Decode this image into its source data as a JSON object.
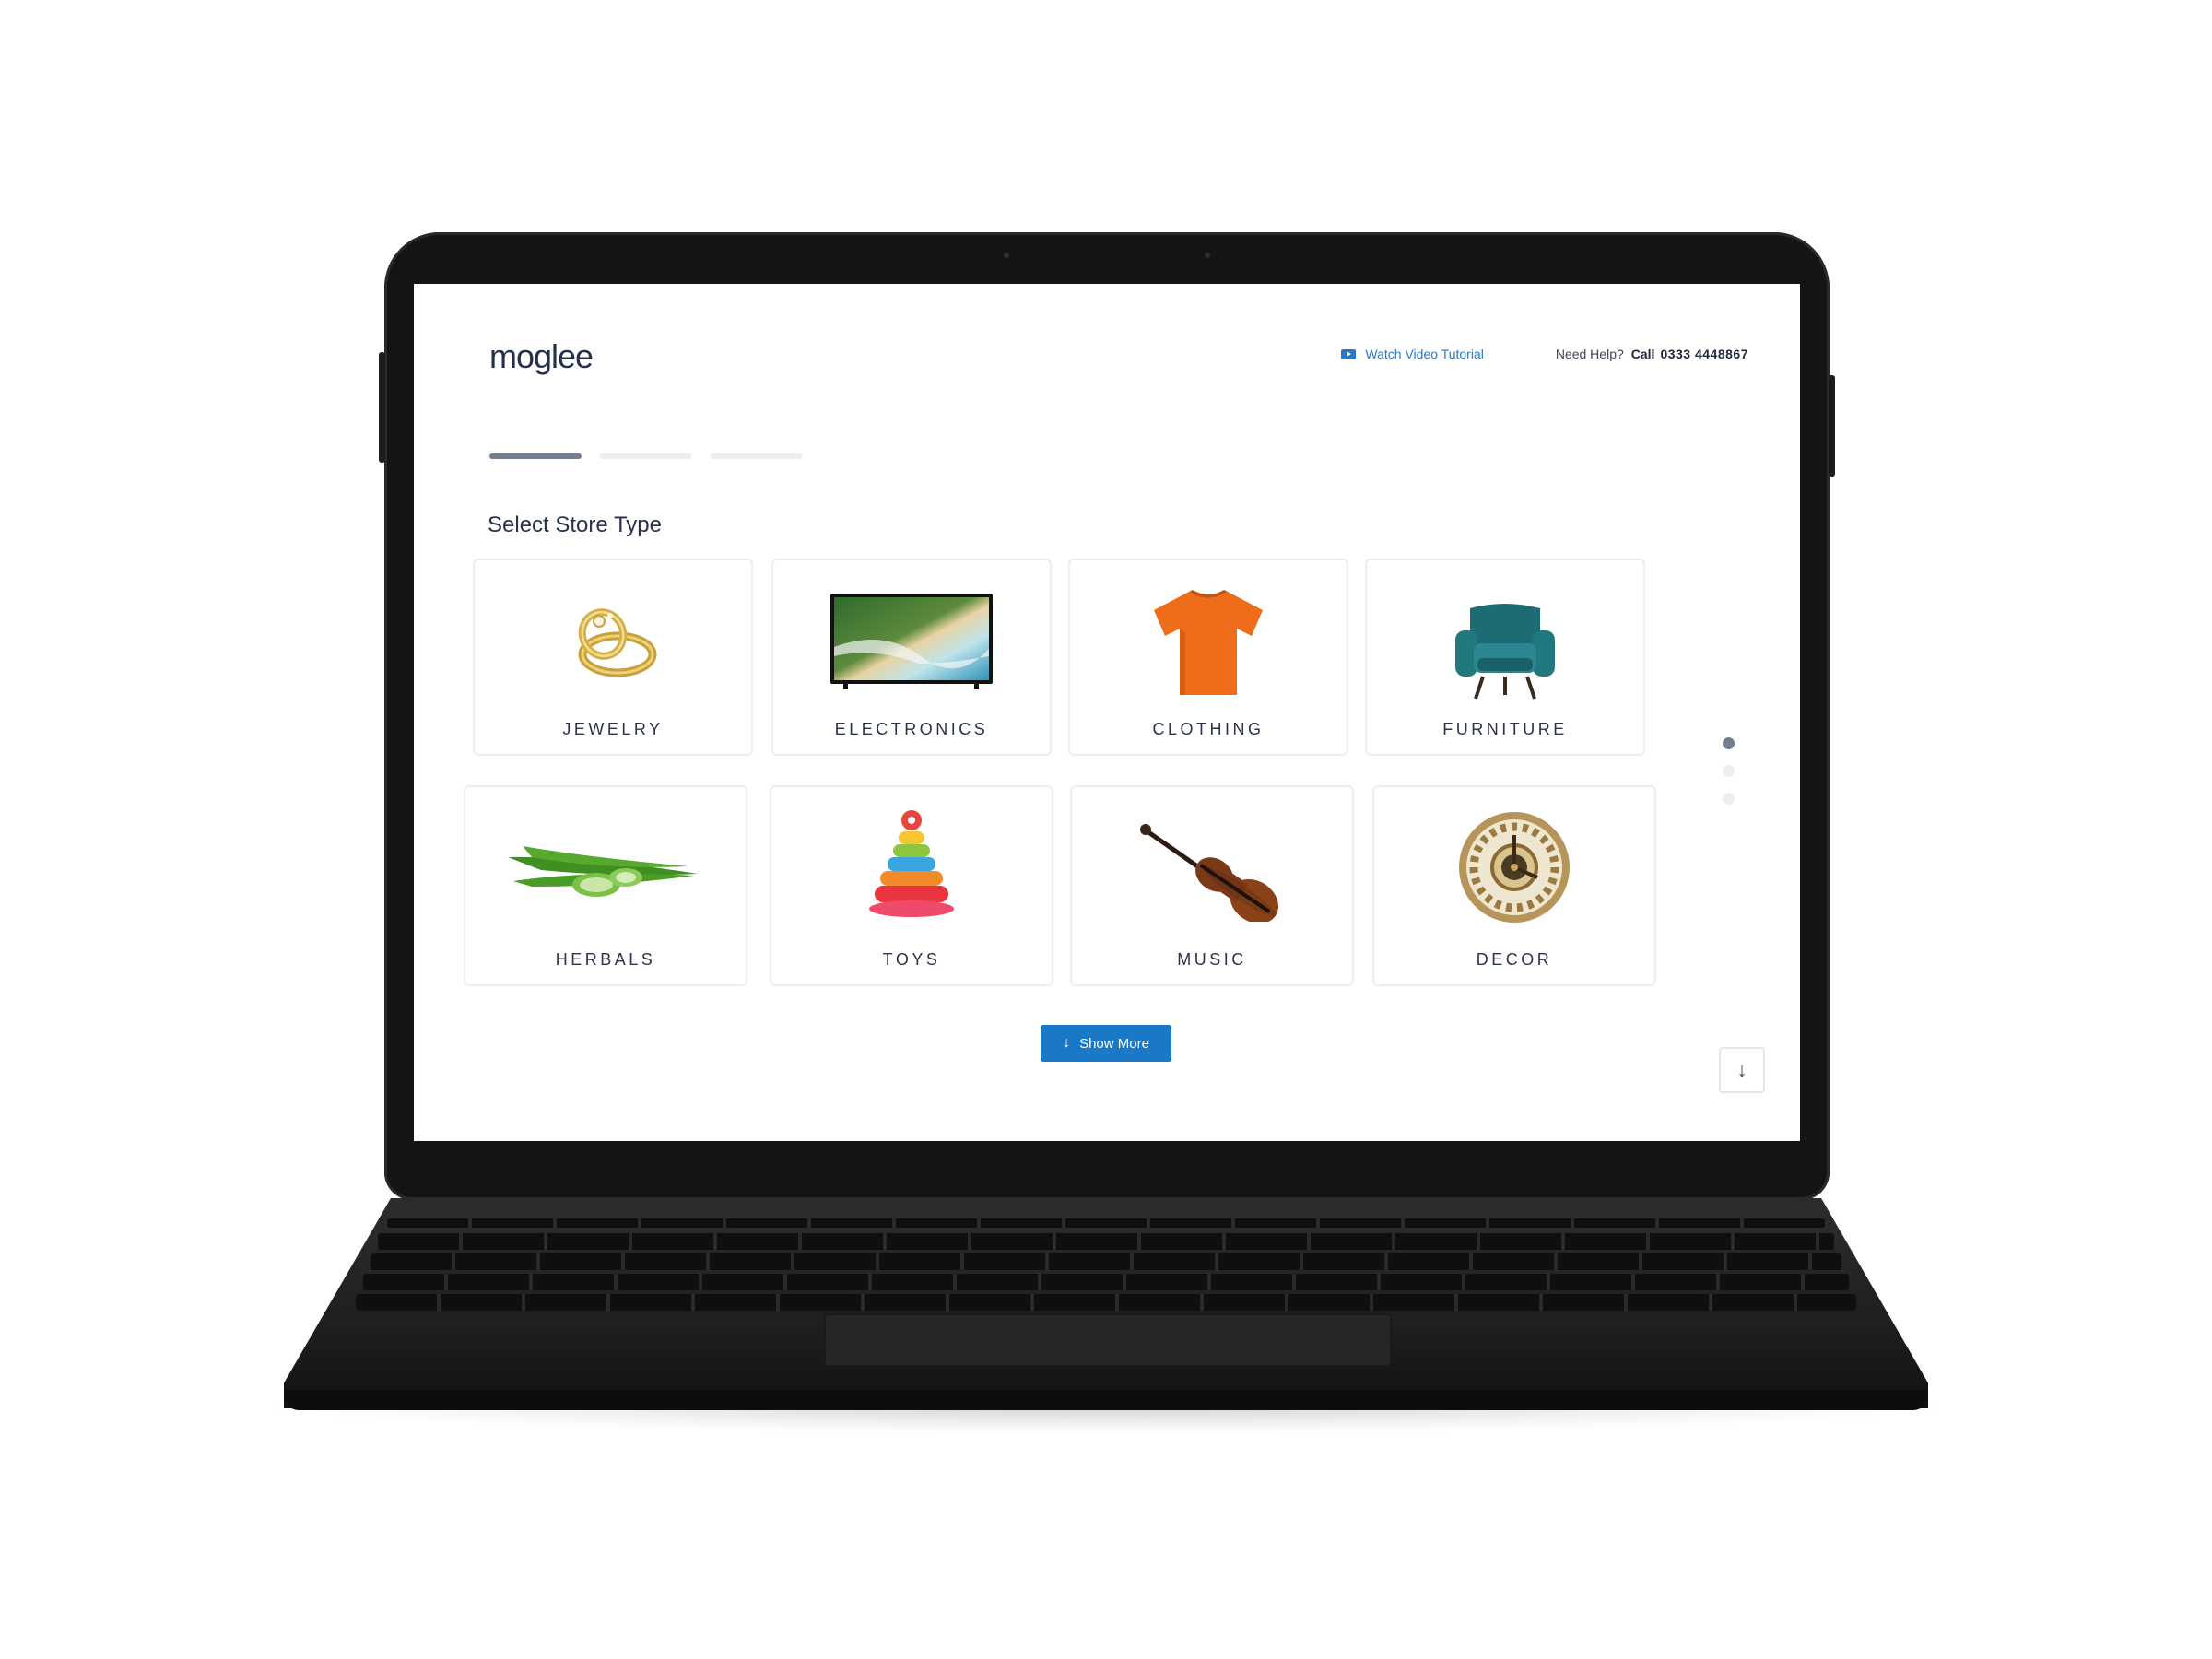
{
  "app": {
    "logo_text": "moglee",
    "brand_colors": {
      "navy": "#25304a",
      "accent": "#e34b52",
      "primary_button": "#1978c8",
      "link": "#2a79c6"
    }
  },
  "header": {
    "tutorial_label": "Watch Video Tutorial",
    "tutorial_icon": "video-play-icon",
    "help_text": "Need Help?",
    "call_label": "Call",
    "phone": "0333 4448867"
  },
  "progress": {
    "total_steps": 3,
    "current_step": 1
  },
  "main": {
    "title": "Select Store Type",
    "store_types": [
      {
        "label": "JEWELRY",
        "icon": "ring-icon"
      },
      {
        "label": "ELECTRONICS",
        "icon": "tv-icon"
      },
      {
        "label": "CLOTHING",
        "icon": "tshirt-icon"
      },
      {
        "label": "FURNITURE",
        "icon": "armchair-icon"
      },
      {
        "label": "HERBALS",
        "icon": "aloe-vera-icon"
      },
      {
        "label": "TOYS",
        "icon": "stacking-rings-toy-icon"
      },
      {
        "label": "MUSIC",
        "icon": "violin-icon"
      },
      {
        "label": "DECOR",
        "icon": "wall-clock-icon"
      }
    ],
    "pagination": {
      "pages": 3,
      "current": 1
    },
    "show_more_label": "Show More",
    "show_more_icon": "arrow-down-icon",
    "scroll_icon": "arrow-down-icon"
  }
}
